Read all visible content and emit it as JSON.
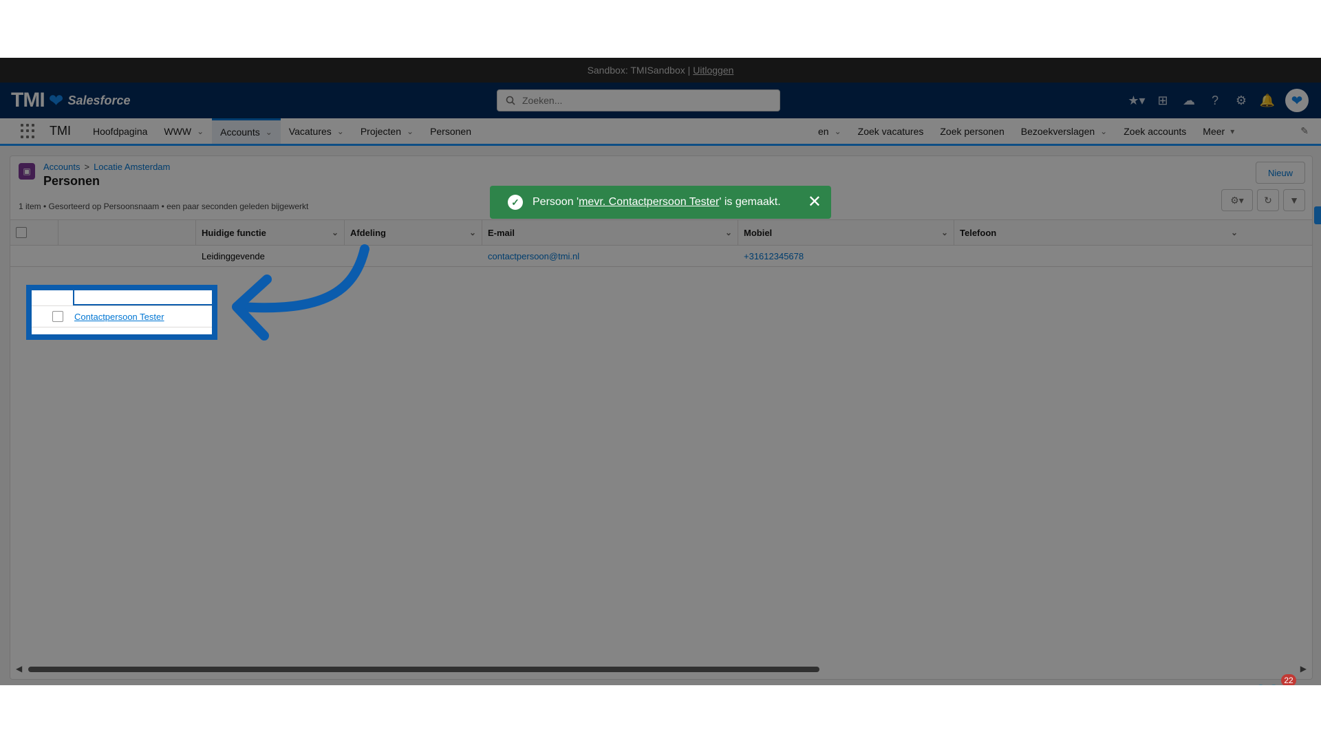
{
  "sandbox_bar": {
    "text": "Sandbox: TMISandbox |",
    "logout": "Uitloggen"
  },
  "header": {
    "logo_tmi": "TMI",
    "logo_salesforce": "Salesforce",
    "search_placeholder": "Zoeken..."
  },
  "nav": {
    "app_name": "TMI",
    "items": [
      {
        "label": "Hoofdpagina",
        "dropdown": false
      },
      {
        "label": "WWW",
        "dropdown": true
      },
      {
        "label": "Accounts",
        "dropdown": true,
        "active": true
      },
      {
        "label": "Vacatures",
        "dropdown": true
      },
      {
        "label": "Projecten",
        "dropdown": true
      },
      {
        "label": "Personen",
        "dropdown": false
      },
      {
        "label": "en",
        "dropdown": true
      },
      {
        "label": "Zoek vacatures",
        "dropdown": false
      },
      {
        "label": "Zoek personen",
        "dropdown": false
      },
      {
        "label": "Bezoekverslagen",
        "dropdown": true
      },
      {
        "label": "Zoek accounts",
        "dropdown": false
      },
      {
        "label": "Meer",
        "dropdown": true
      }
    ]
  },
  "page": {
    "breadcrumb": [
      "Accounts",
      "Locatie Amsterdam"
    ],
    "breadcrumb_sep": ">",
    "title": "Personen",
    "meta": "1 item • Gesorteerd op Persoonsnaam • een paar seconden geleden bijgewerkt",
    "new_button": "Nieuw"
  },
  "table": {
    "columns": [
      "Huidige functie",
      "Afdeling",
      "E-mail",
      "Mobiel",
      "Telefoon"
    ],
    "rows": [
      {
        "name": "Contactpersoon Tester",
        "functie": "Leidinggevende",
        "afdeling": "",
        "email": "contactpersoon@tmi.nl",
        "mobiel": "+31612345678",
        "telefoon": ""
      }
    ]
  },
  "toast": {
    "prefix": "Persoon '",
    "link": "mevr. Contactpersoon Tester",
    "suffix": "' is gemaakt."
  },
  "widget": {
    "badge": "22"
  },
  "colors": {
    "header": "#032d60",
    "toast": "#2e844a",
    "highlight": "#0b5cad",
    "accent": "#0176d3"
  }
}
